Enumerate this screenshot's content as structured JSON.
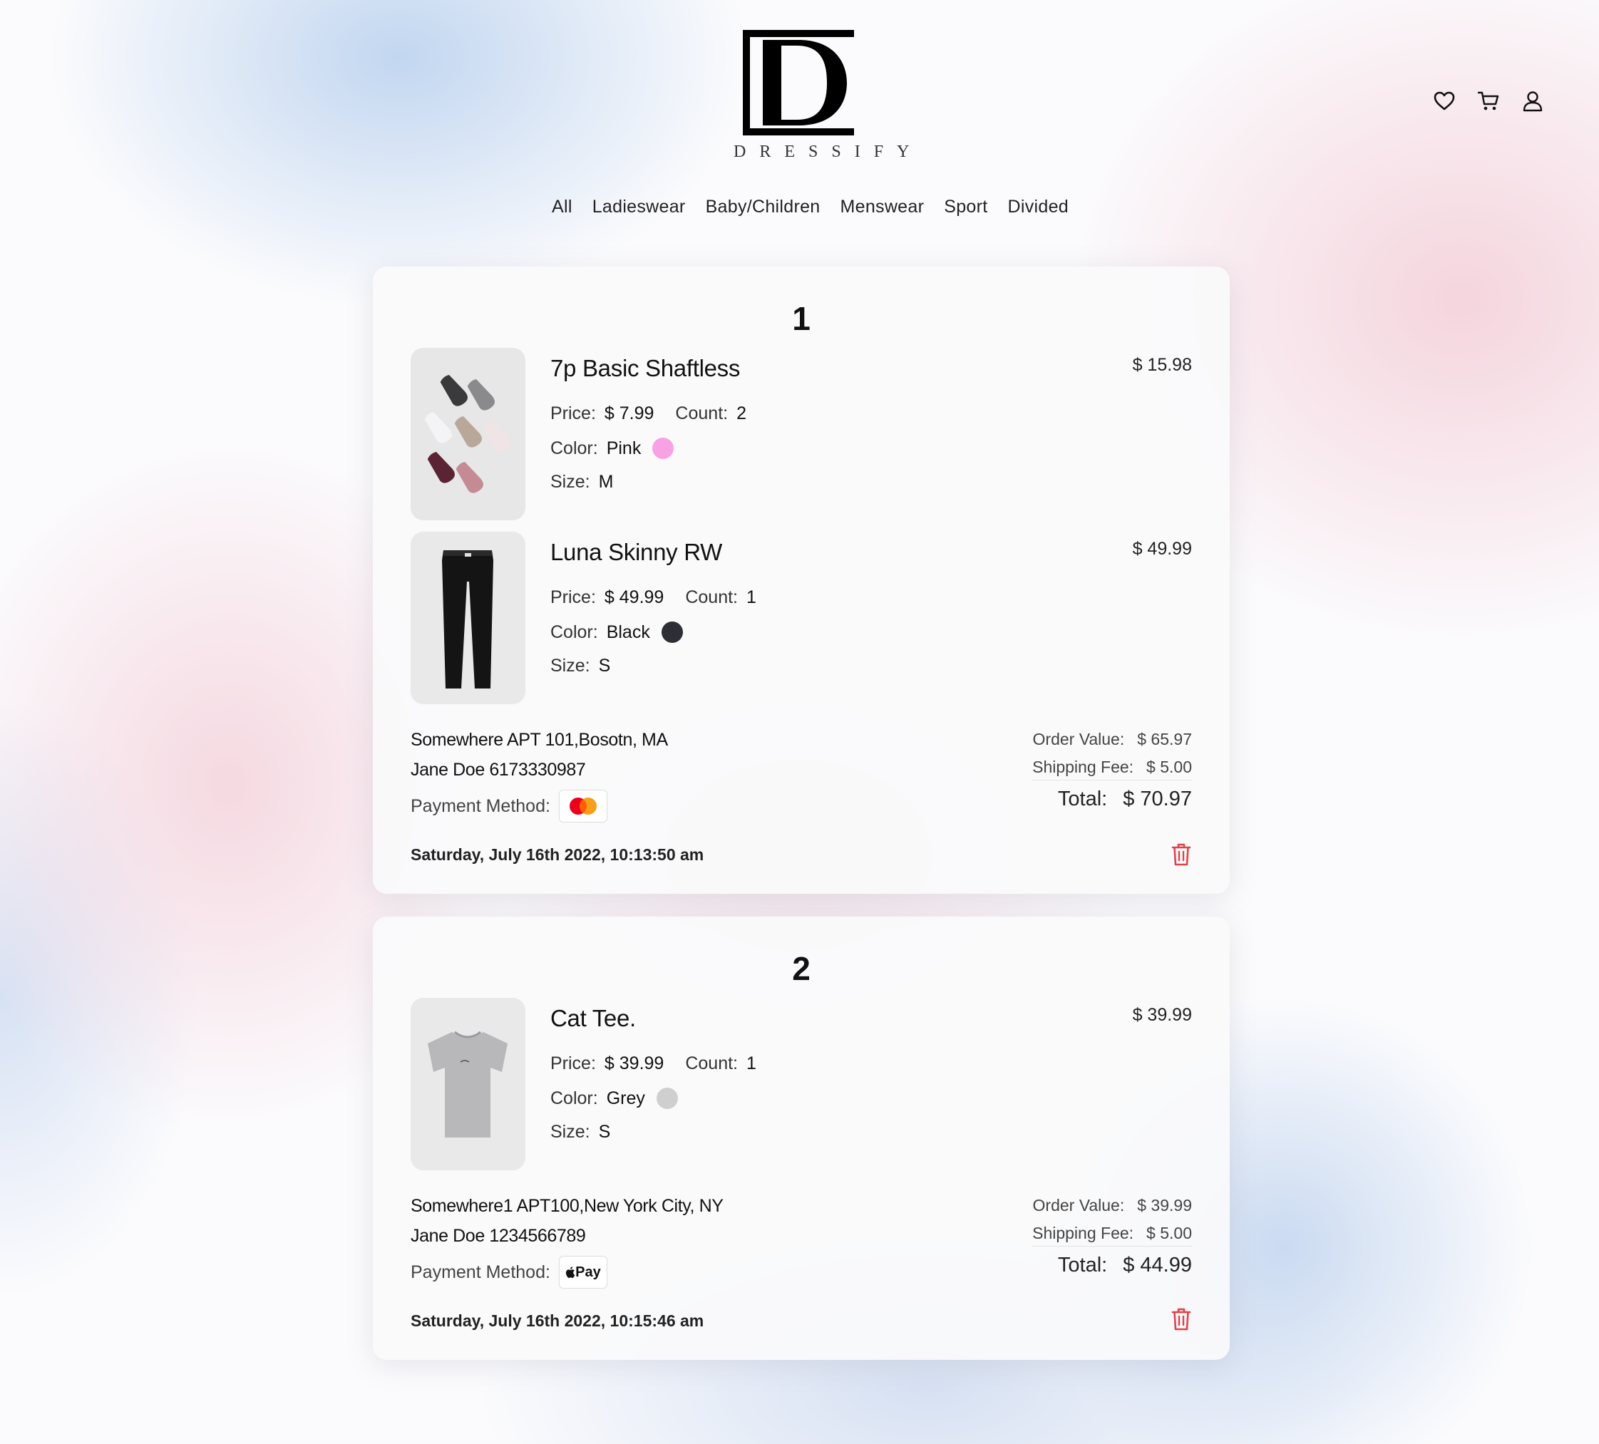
{
  "brand": {
    "name": "DRESSIFY",
    "mark": "D"
  },
  "header_icons": [
    "heart-icon",
    "cart-icon",
    "user-icon"
  ],
  "categories": [
    "All",
    "Ladieswear",
    "Baby/Children",
    "Menswear",
    "Sport",
    "Divided"
  ],
  "labels": {
    "price": "Price:",
    "count": "Count:",
    "color": "Color:",
    "size": "Size:",
    "payment_method": "Payment Method:",
    "order_value": "Order Value:",
    "shipping_fee": "Shipping Fee:",
    "total": "Total:"
  },
  "orders": [
    {
      "number": "1",
      "items": [
        {
          "name": "7p Basic Shaftless",
          "line_total": "$ 15.98",
          "price": "$ 7.99",
          "count": "2",
          "color": "Pink",
          "color_hex": "#f8a2e6",
          "size": "M",
          "image": "socks-image"
        },
        {
          "name": "Luna Skinny RW",
          "line_total": "$ 49.99",
          "price": "$ 49.99",
          "count": "1",
          "color": "Black",
          "color_hex": "#2c3035",
          "size": "S",
          "image": "jeans-image"
        }
      ],
      "address": "Somewhere  APT 101,Bosotn, MA",
      "contact": "Jane Doe   6173330987",
      "payment": "mastercard-icon",
      "order_value": "$ 65.97",
      "shipping_fee": "$ 5.00",
      "total": "$ 70.97",
      "timestamp": "Saturday, July 16th 2022, 10:13:50 am"
    },
    {
      "number": "2",
      "items": [
        {
          "name": "Cat Tee.",
          "line_total": "$ 39.99",
          "price": "$ 39.99",
          "count": "1",
          "color": "Grey",
          "color_hex": "#cfcfcf",
          "size": "S",
          "image": "tshirt-image"
        }
      ],
      "address": "Somewhere1  APT100,New York City, NY",
      "contact": "Jane Doe   1234566789",
      "payment": "apple-pay-icon",
      "payment_text": "Pay",
      "order_value": "$ 39.99",
      "shipping_fee": "$ 5.00",
      "total": "$ 44.99",
      "timestamp": "Saturday, July 16th 2022, 10:15:46 am"
    }
  ]
}
